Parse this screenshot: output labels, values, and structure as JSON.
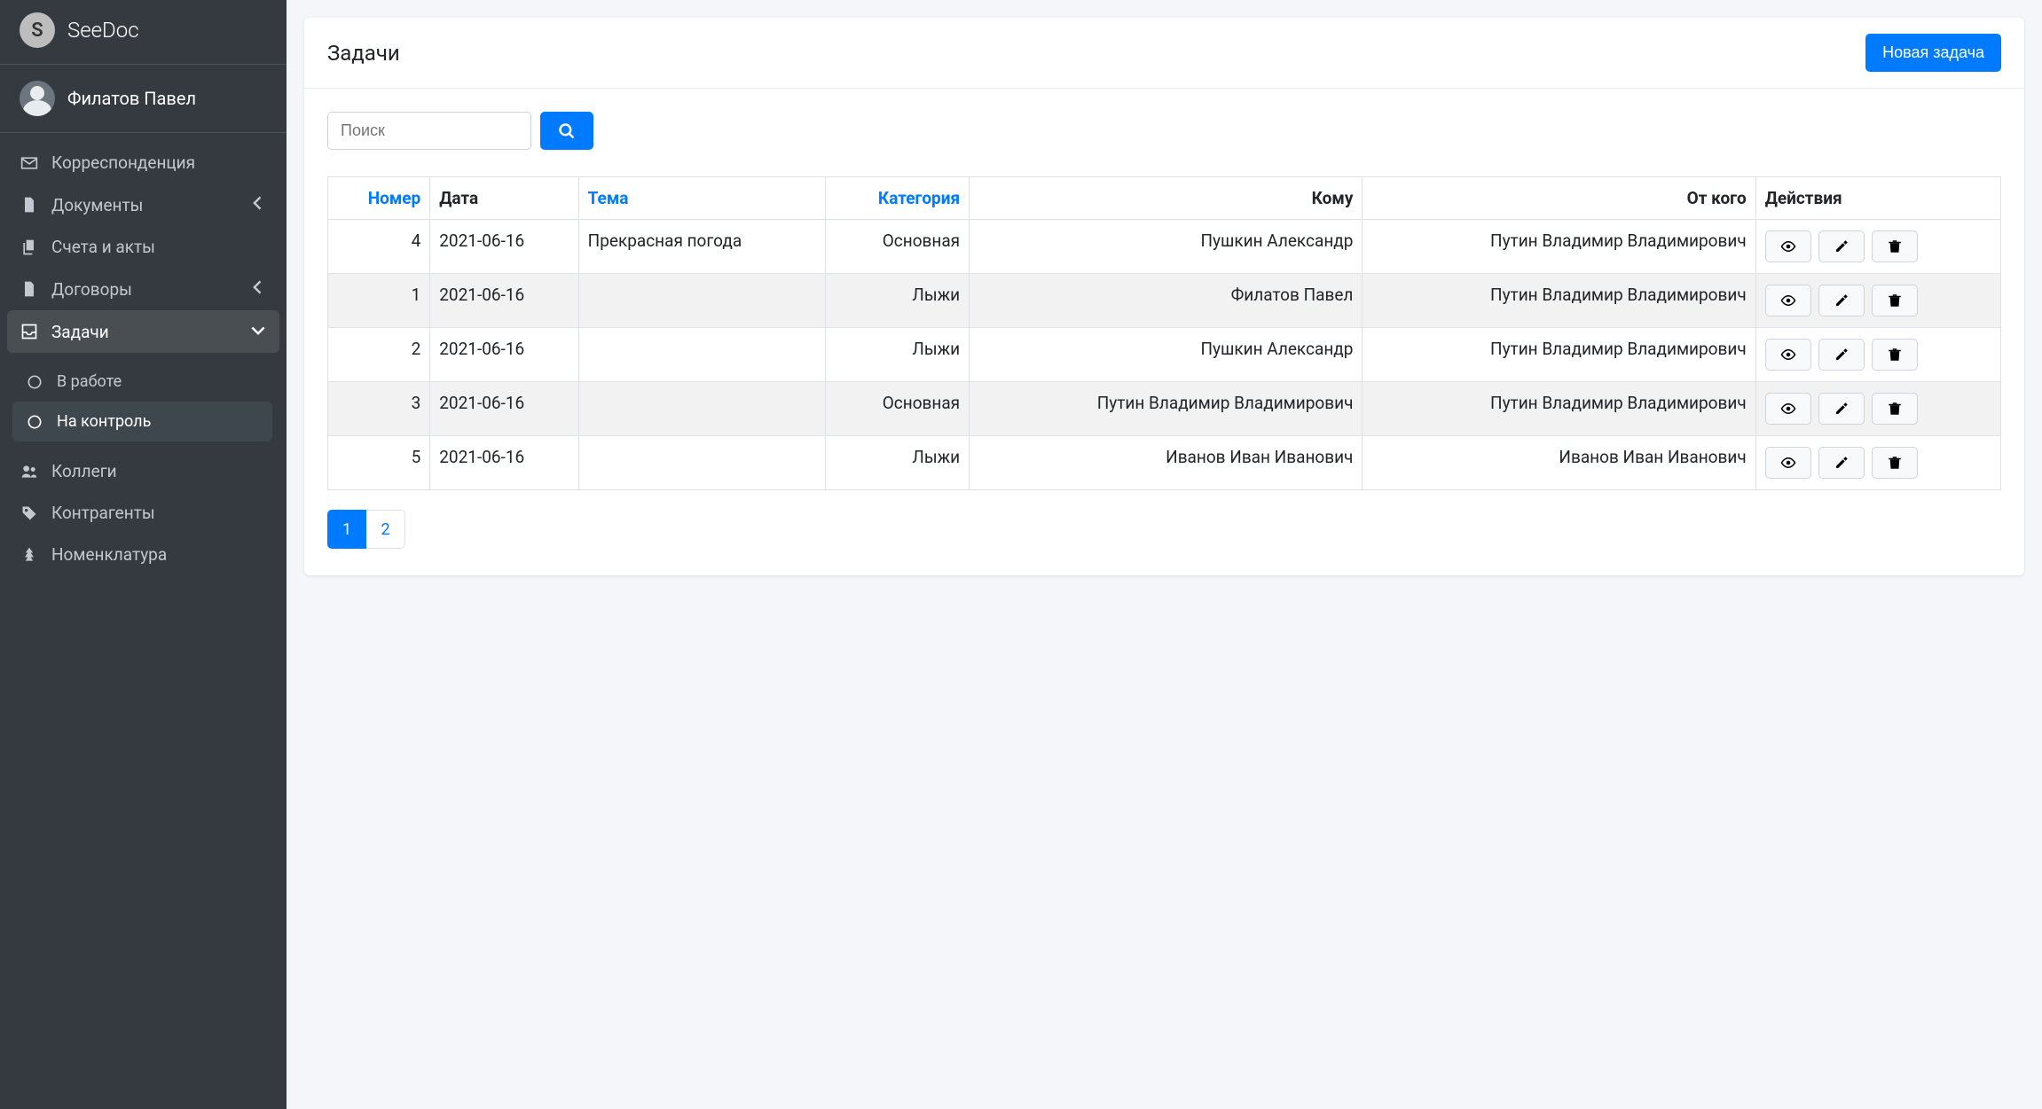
{
  "brand": {
    "logo_letter": "S",
    "name": "SeeDoc"
  },
  "user": {
    "name": "Филатов Павел"
  },
  "sidebar": {
    "items": [
      {
        "icon": "envelope",
        "label": "Корреспонденция",
        "expandable": false
      },
      {
        "icon": "file",
        "label": "Документы",
        "expandable": true
      },
      {
        "icon": "copy",
        "label": "Счета и акты",
        "expandable": false
      },
      {
        "icon": "file",
        "label": "Договоры",
        "expandable": true
      },
      {
        "icon": "inbox",
        "label": "Задачи",
        "expandable": true,
        "active": true,
        "children": [
          {
            "icon": "circle",
            "label": "В работе"
          },
          {
            "icon": "circle",
            "label": "На контроль",
            "hover": true
          }
        ]
      },
      {
        "icon": "users",
        "label": "Коллеги",
        "expandable": false
      },
      {
        "icon": "tag",
        "label": "Контрагенты",
        "expandable": false
      },
      {
        "icon": "tree",
        "label": "Номенклатура",
        "expandable": false
      }
    ]
  },
  "page": {
    "title": "Задачи",
    "new_button": "Новая задача",
    "search_placeholder": "Поиск"
  },
  "table": {
    "headers": {
      "number": "Номер",
      "date": "Дата",
      "subject": "Тема",
      "category": "Категория",
      "to": "Кому",
      "from": "От кого",
      "actions": "Действия"
    },
    "rows": [
      {
        "num": "4",
        "date": "2021-06-16",
        "subject": "Прекрасная погода",
        "category": "Основная",
        "to": "Пушкин Александр",
        "from": "Путин Владимир Владимирович"
      },
      {
        "num": "1",
        "date": "2021-06-16",
        "subject": "",
        "category": "Лыжи",
        "to": "Филатов Павел",
        "from": "Путин Владимир Владимирович"
      },
      {
        "num": "2",
        "date": "2021-06-16",
        "subject": "",
        "category": "Лыжи",
        "to": "Пушкин Александр",
        "from": "Путин Владимир Владимирович"
      },
      {
        "num": "3",
        "date": "2021-06-16",
        "subject": "",
        "category": "Основная",
        "to": "Путин Владимир Владимирович",
        "from": "Путин Владимир Владимирович"
      },
      {
        "num": "5",
        "date": "2021-06-16",
        "subject": "",
        "category": "Лыжи",
        "to": "Иванов Иван Иванович",
        "from": "Иванов Иван Иванович"
      }
    ]
  },
  "pagination": {
    "pages": [
      "1",
      "2"
    ],
    "active": "1"
  }
}
